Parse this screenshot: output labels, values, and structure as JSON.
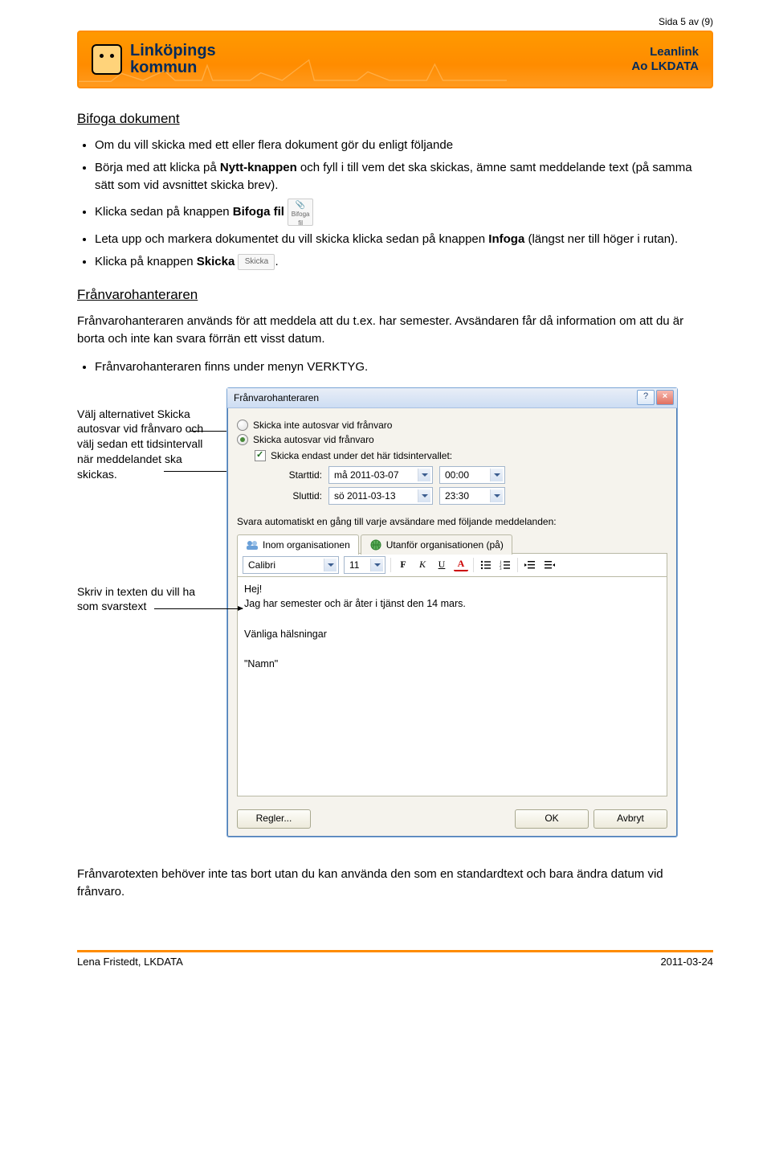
{
  "page_label": "Sida 5 av (9)",
  "banner": {
    "org1": "Linköpings",
    "org2": "kommun",
    "right1": "Leanlink",
    "right2": "Ao LKDATA"
  },
  "section1": {
    "heading": "Bifoga dokument",
    "b1_pre": "Om du vill skicka med ett eller flera dokument gör du enligt följande",
    "b2_a": "Börja med att klicka på ",
    "b2_bold": "Nytt-knappen",
    "b2_b": " och fyll i till vem det ska skickas, ämne samt meddelande text (på samma sätt som vid avsnittet skicka brev).",
    "b3_a": "Klicka sedan på knappen ",
    "b3_bold": "Bifoga fil",
    "attach_icon_label": "Bifoga fil",
    "b4_a": "Leta upp och markera dokumentet du vill skicka klicka sedan på knappen ",
    "b4_bold": "Infoga",
    "b4_b": " (längst ner till höger i rutan).",
    "b5_a": "Klicka på knappen ",
    "b5_bold": "Skicka",
    "send_icon_label": "Skicka",
    "b5_b": "."
  },
  "section2": {
    "heading": "Frånvarohanteraren",
    "para": "Frånvarohanteraren används för att meddela att du t.ex. har semester. Avsändaren får då information om att du är borta och inte kan svara förrän ett visst datum.",
    "b1": "Frånvarohanteraren finns under menyn VERKTYG."
  },
  "annot1": "Välj alternativet Skicka autosvar vid frånvaro och välj sedan ett tidsintervall när meddelandet ska skickas.",
  "annot2": "Skriv in texten du vill ha som svarstext",
  "dialog": {
    "title": "Frånvarohanteraren",
    "radio_off": "Skicka inte autosvar vid frånvaro",
    "radio_on": "Skicka autosvar vid frånvaro",
    "check_interval": "Skicka endast under det här tidsintervallet:",
    "start_label": "Starttid:",
    "start_date": "må 2011-03-07",
    "start_time": "00:00",
    "end_label": "Sluttid:",
    "end_date": "sö 2011-03-13",
    "end_time": "23:30",
    "auto_reply_text": "Svara automatiskt en gång till varje avsändare med följande meddelanden:",
    "tab1": "Inom organisationen",
    "tab2": "Utanför organisationen (på)",
    "font": "Calibri",
    "size": "11",
    "editor_text": "Hej!\nJag har semester och är åter i tjänst den 14 mars.\n\nVänliga hälsningar\n\n\"Namn\"",
    "btn_rules": "Regler...",
    "btn_ok": "OK",
    "btn_cancel": "Avbryt"
  },
  "bottom_note": "Frånvarotexten behöver inte tas bort utan du kan använda den som en standardtext och bara ändra datum vid frånvaro.",
  "footer_left": "Lena Fristedt, LKDATA",
  "footer_right": "2011-03-24"
}
